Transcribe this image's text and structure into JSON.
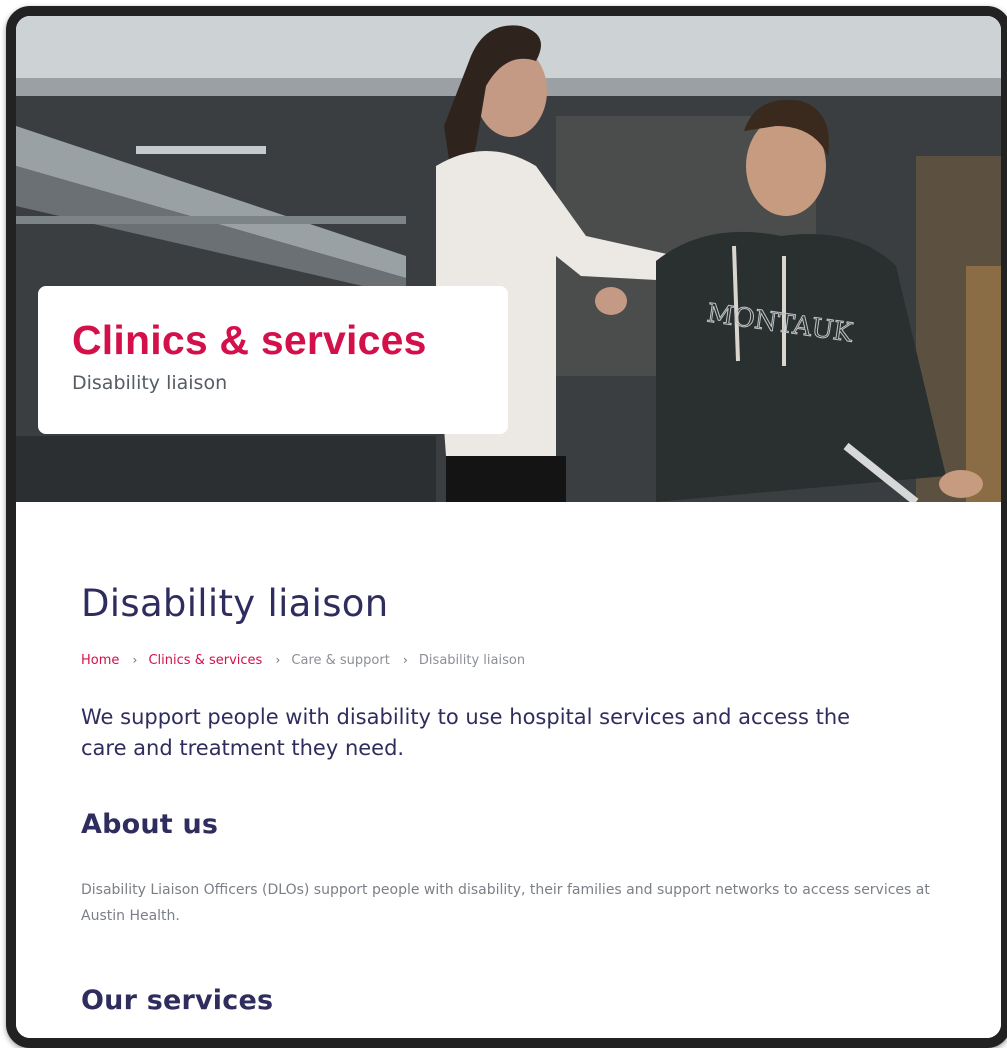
{
  "hero": {
    "title": "Clinics & services",
    "subtitle": "Disability liaison"
  },
  "page": {
    "title": "Disability liaison",
    "intro": "We support people with disability to use hospital services and access the care and treatment they need."
  },
  "breadcrumb": {
    "items": [
      {
        "label": "Home",
        "link": true
      },
      {
        "label": "Clinics & services",
        "link": true
      },
      {
        "label": "Care & support",
        "link": false
      },
      {
        "label": "Disability liaison",
        "link": false
      }
    ],
    "separator": "›"
  },
  "about": {
    "heading": "About us",
    "body": "Disability Liaison Officers (DLOs) support people with disability, their families and support networks to access services at Austin Health."
  },
  "services": {
    "heading": "Our services"
  },
  "colors": {
    "accent": "#d4104b",
    "heading": "#2f2d5e",
    "body": "#7b7f86"
  }
}
